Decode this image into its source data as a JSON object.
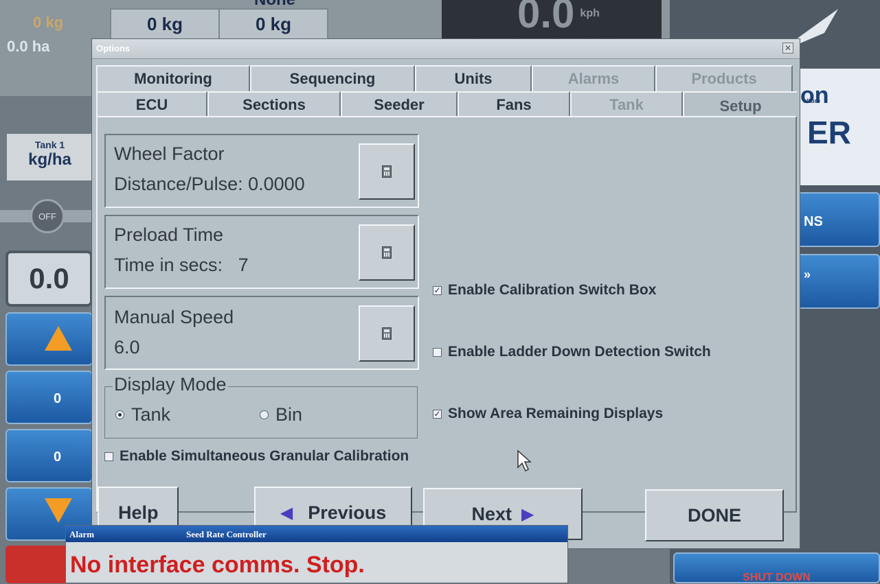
{
  "background": {
    "stat_values": [
      "0 kg",
      "0.0 ha"
    ],
    "product_cells": [
      "0 kg",
      "0 kg"
    ],
    "product_header_partial": "None",
    "speed_value": "0.0",
    "speed_unit": "kph",
    "logo_text_1": "on",
    "logo_text_2": "ulture",
    "logo_text_3": "ER",
    "tank_label": "Tank 1",
    "tank_unit": "kg/ha",
    "off_label": "OFF",
    "display_value": "0.0",
    "counter_values": [
      "0",
      "0"
    ],
    "right_btn_label": "NS",
    "right_btn2_label": "»",
    "shutdown_label": "SHUT DOWN"
  },
  "window": {
    "title": "Options",
    "close_glyph": "✕"
  },
  "tabs_row1": [
    {
      "label": "Monitoring",
      "state": "normal"
    },
    {
      "label": "Sequencing",
      "state": "normal"
    },
    {
      "label": "Units",
      "state": "normal"
    },
    {
      "label": "Alarms",
      "state": "dim"
    },
    {
      "label": "Products",
      "state": "dim"
    }
  ],
  "tabs_row2": [
    {
      "label": "ECU",
      "state": "normal"
    },
    {
      "label": "Sections",
      "state": "normal"
    },
    {
      "label": "Seeder",
      "state": "normal"
    },
    {
      "label": "Fans",
      "state": "normal"
    },
    {
      "label": "Tank",
      "state": "dim"
    },
    {
      "label": "Setup",
      "state": "active"
    }
  ],
  "settings": {
    "wheel_factor": {
      "title": "Wheel Factor",
      "line2_label": "Distance/Pulse:",
      "value": "0.0000"
    },
    "preload_time": {
      "title": "Preload Time",
      "line2_label": "Time in secs:",
      "value": "7"
    },
    "manual_speed": {
      "title": "Manual Speed",
      "value": "6.0"
    },
    "display_mode": {
      "legend": "Display Mode",
      "options": [
        {
          "label": "Tank",
          "selected": true
        },
        {
          "label": "Bin",
          "selected": false
        }
      ]
    },
    "simultaneous_granular": {
      "label": "Enable Simultaneous Granular Calibration",
      "checked": false
    }
  },
  "checkboxes": [
    {
      "label": "Enable Calibration Switch Box",
      "checked": true
    },
    {
      "label": "Enable Ladder Down Detection Switch",
      "checked": false
    },
    {
      "label": "Show Area Remaining Displays",
      "checked": true
    }
  ],
  "footer": {
    "help": "Help",
    "previous": "Previous",
    "next": "Next",
    "done": "DONE",
    "prev_arrow": "◀",
    "next_arrow": "▶"
  },
  "alarm": {
    "tag": "Alarm",
    "source": "Seed Rate Controller",
    "message": "No interface comms. Stop."
  },
  "colors": {
    "window_bg": "#b6c0c7",
    "accent_arrow": "#4b3fbf",
    "alarm_text": "#cf1f1f",
    "alarm_title": "#1f57a8"
  }
}
